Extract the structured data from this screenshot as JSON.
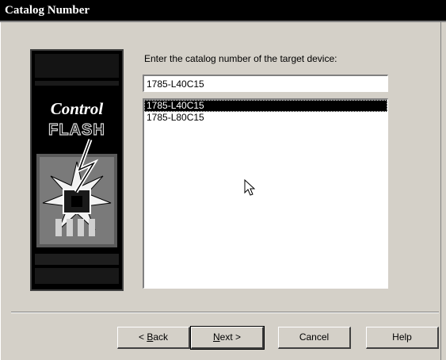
{
  "window": {
    "title": "Catalog Number"
  },
  "banner": {
    "line1": "Control",
    "line2": "FLASH"
  },
  "form": {
    "prompt": "Enter the catalog number of the target device:",
    "entry_value": "1785-L40C15"
  },
  "catalog_list": {
    "items": [
      "1785-L40C15",
      "1785-L80C15"
    ],
    "selected_index": 0
  },
  "buttons": {
    "back_prefix": "< ",
    "back_accel": "B",
    "back_rest": "ack",
    "next_accel": "N",
    "next_rest": "ext >",
    "cancel": "Cancel",
    "help": "Help"
  },
  "colors": {
    "title_bar": "#000000",
    "face": "#d4d0c8",
    "selection": "#000000"
  }
}
